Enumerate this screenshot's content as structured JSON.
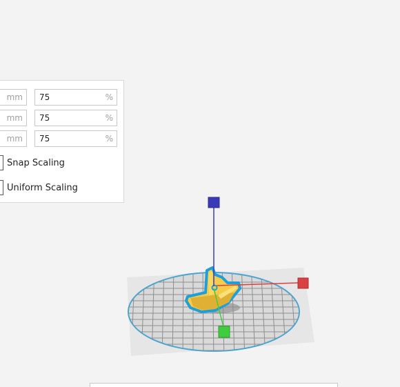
{
  "scale_panel": {
    "rows": [
      {
        "axis": "x",
        "mm_unit": "mm",
        "percent": "75",
        "percent_unit": "%"
      },
      {
        "axis": "y",
        "mm_unit": "mm",
        "percent": "75",
        "percent_unit": "%"
      },
      {
        "axis": "z",
        "mm_unit": "mm",
        "percent": "75",
        "percent_unit": "%"
      }
    ],
    "snap_scaling_label": "Snap Scaling",
    "uniform_scaling_label": "Uniform Scaling"
  },
  "viewport": {
    "handle_colors": {
      "x_axis": "#d94040",
      "y_axis": "#3a3ab8",
      "z_axis": "#3fcc3f"
    },
    "model_color": "#f4cc4a",
    "selection_outline_color": "#1e9fd8",
    "build_plate_edge_color": "#4aa7d3"
  }
}
